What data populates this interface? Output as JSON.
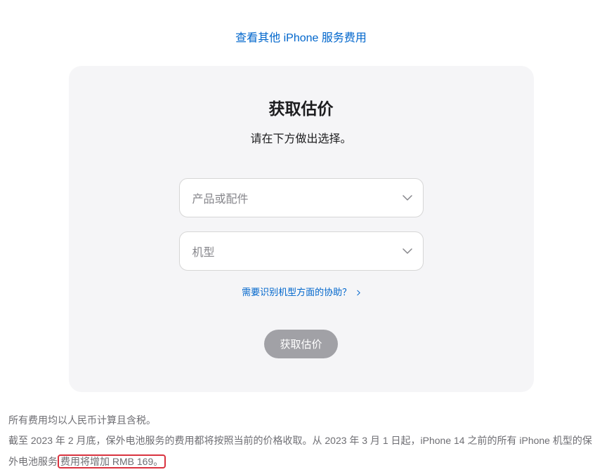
{
  "topLink": "查看其他 iPhone 服务费用",
  "card": {
    "title": "获取估价",
    "subtitle": "请在下方做出选择。",
    "productSelect": "产品或配件",
    "modelSelect": "机型",
    "helpLink": "需要识别机型方面的协助？",
    "button": "获取估价"
  },
  "footer": {
    "line1": "所有费用均以人民币计算且含税。",
    "line2_part1": "截至 2023 年 2 月底，保外电池服务的费用都将按照当前的价格收取。从 2023 年 3 月 1 日起，iPhone 14 之前的所有 iPhone 机型的保外电池服务",
    "line2_highlighted": "费用将增加 RMB 169。"
  }
}
